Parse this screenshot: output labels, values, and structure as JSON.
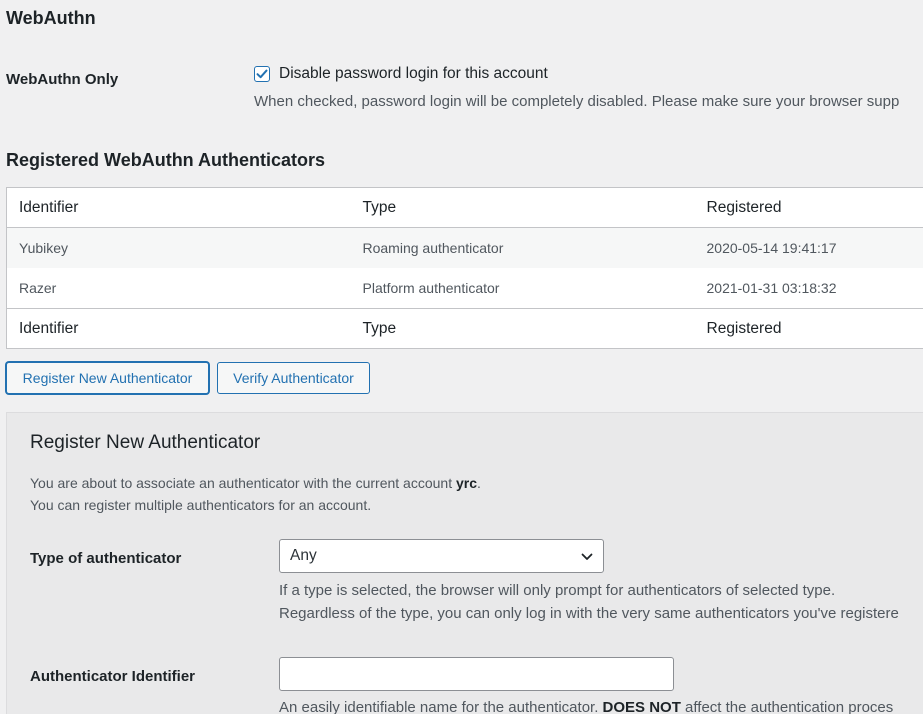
{
  "header": {
    "title": "WebAuthn"
  },
  "webauthn_only": {
    "label": "WebAuthn Only",
    "checkbox_label": "Disable password login for this account",
    "checked": true,
    "description": "When checked, password login will be completely disabled. Please make sure your browser supp"
  },
  "authenticators": {
    "heading": "Registered WebAuthn Authenticators",
    "columns": [
      "Identifier",
      "Type",
      "Registered"
    ],
    "rows": [
      {
        "identifier": "Yubikey",
        "type": "Roaming authenticator",
        "registered": "2020-05-14 19:41:17"
      },
      {
        "identifier": "Razer",
        "type": "Platform authenticator",
        "registered": "2021-01-31 03:18:32"
      }
    ]
  },
  "actions": {
    "register_label": "Register New Authenticator",
    "verify_label": "Verify Authenticator"
  },
  "register_panel": {
    "title": "Register New Authenticator",
    "intro_before": "You are about to associate an authenticator with the current account ",
    "account": "yrc",
    "intro_after": ".",
    "intro_line2": "You can register multiple authenticators for an account.",
    "type_label": "Type of authenticator",
    "type_value": "Any",
    "type_help_1": "If a type is selected, the browser will only prompt for authenticators of selected type.",
    "type_help_2": "Regardless of the type, you can only log in with the very same authenticators you've registere",
    "identifier_label": "Authenticator Identifier",
    "identifier_value": "",
    "identifier_help_before": "An easily identifiable name for the authenticator. ",
    "identifier_help_bold": "DOES NOT",
    "identifier_help_after": " affect the authentication proces"
  },
  "colors": {
    "accent": "#2271b1",
    "background": "#f0f0f1",
    "panel": "#e9e9ea"
  },
  "icons": {
    "checkbox": "checkmark-icon",
    "select": "chevron-down-icon"
  }
}
